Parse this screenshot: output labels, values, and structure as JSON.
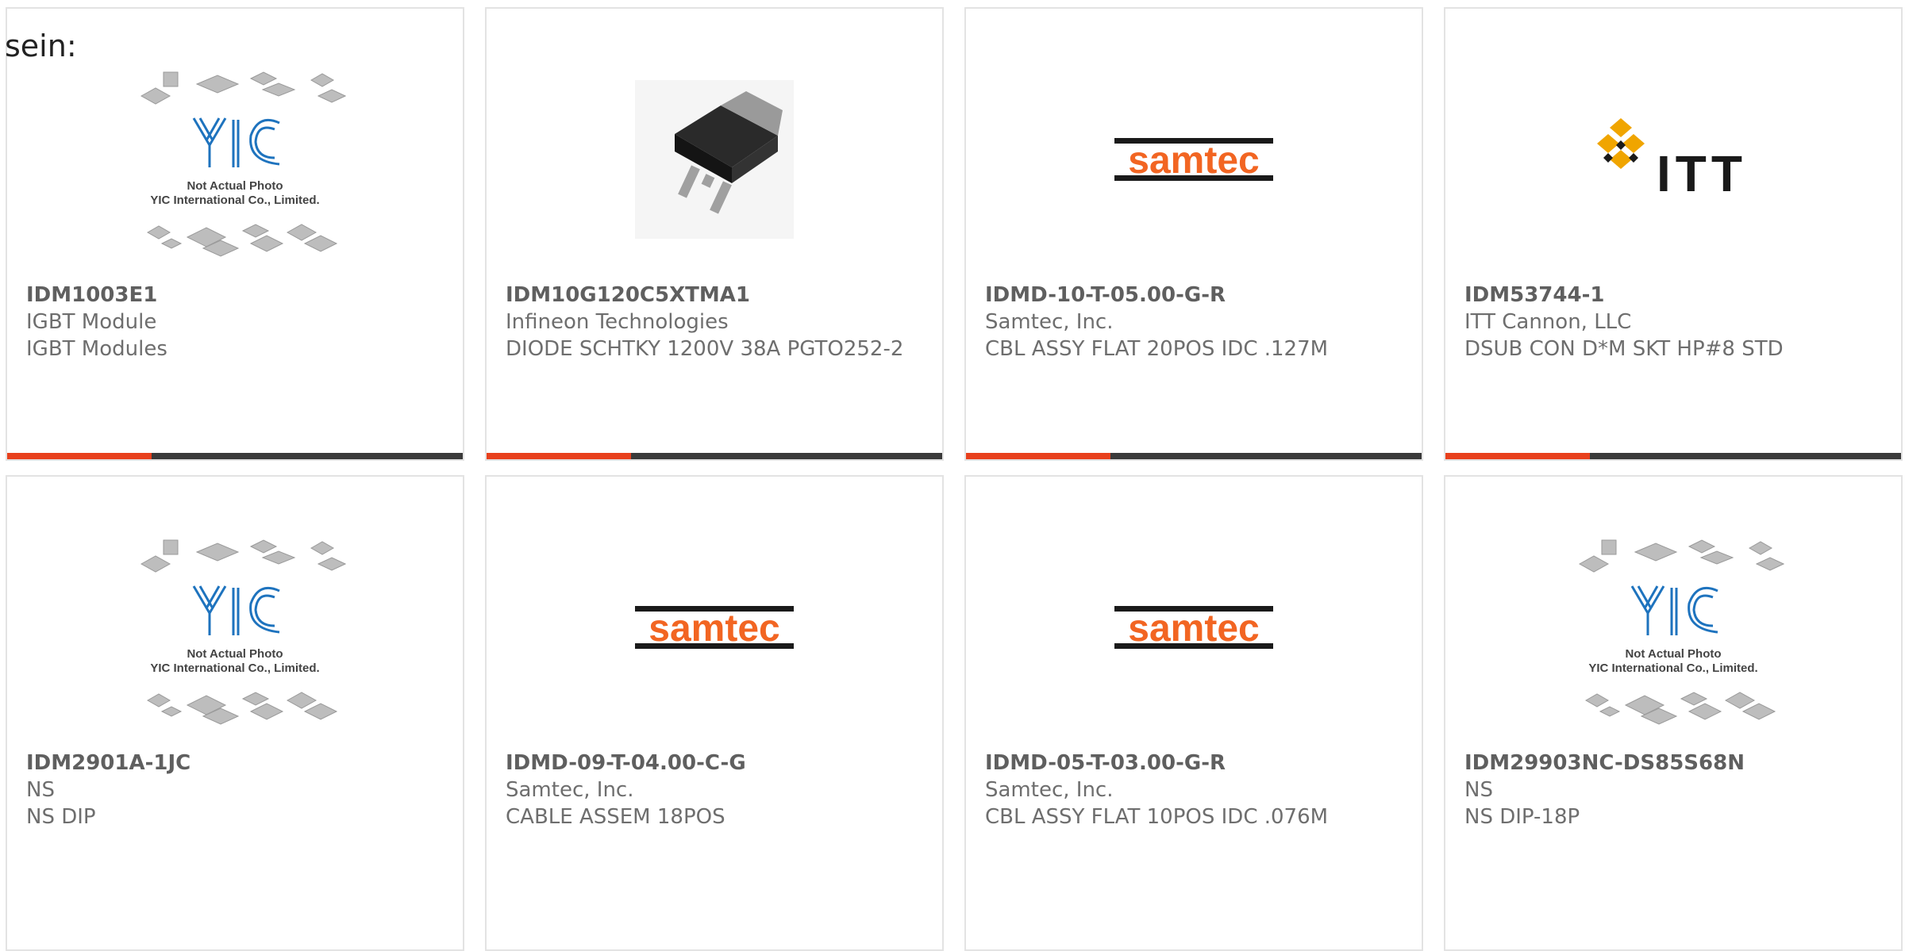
{
  "intro_text": "sein:",
  "placeholder": {
    "line1": "Not Actual Photo",
    "line2": "YIC International Co., Limited.",
    "logo": "YIC"
  },
  "logos": {
    "samtec": "samtec",
    "itt": "ITT"
  },
  "colors": {
    "accent": "#e8401c",
    "bar": "#3a3a3a",
    "samtec_orange": "#f26522"
  },
  "products": [
    {
      "part": "IDM1003E1",
      "maker": "IGBT Module",
      "desc": "IGBT Modules",
      "image": "yic-placeholder"
    },
    {
      "part": "IDM10G120C5XTMA1",
      "maker": "Infineon Technologies",
      "desc": "DIODE SCHTKY 1200V 38A PGTO252-2",
      "image": "to252-package"
    },
    {
      "part": "IDMD-10-T-05.00-G-R",
      "maker": "Samtec, Inc.",
      "desc": "CBL ASSY FLAT 20POS IDC .127M",
      "image": "samtec-logo"
    },
    {
      "part": "IDM53744-1",
      "maker": "ITT Cannon, LLC",
      "desc": "DSUB CON D*M SKT HP#8 STD",
      "image": "itt-logo"
    },
    {
      "part": "IDM2901A-1JC",
      "maker": "NS",
      "desc": "NS DIP",
      "image": "yic-placeholder"
    },
    {
      "part": "IDMD-09-T-04.00-C-G",
      "maker": "Samtec, Inc.",
      "desc": "CABLE ASSEM 18POS",
      "image": "samtec-logo"
    },
    {
      "part": "IDMD-05-T-03.00-G-R",
      "maker": "Samtec, Inc.",
      "desc": "CBL ASSY FLAT 10POS IDC .076M",
      "image": "samtec-logo"
    },
    {
      "part": "IDM29903NC-DS85S68N",
      "maker": "NS",
      "desc": "NS DIP-18P",
      "image": "yic-placeholder"
    }
  ]
}
